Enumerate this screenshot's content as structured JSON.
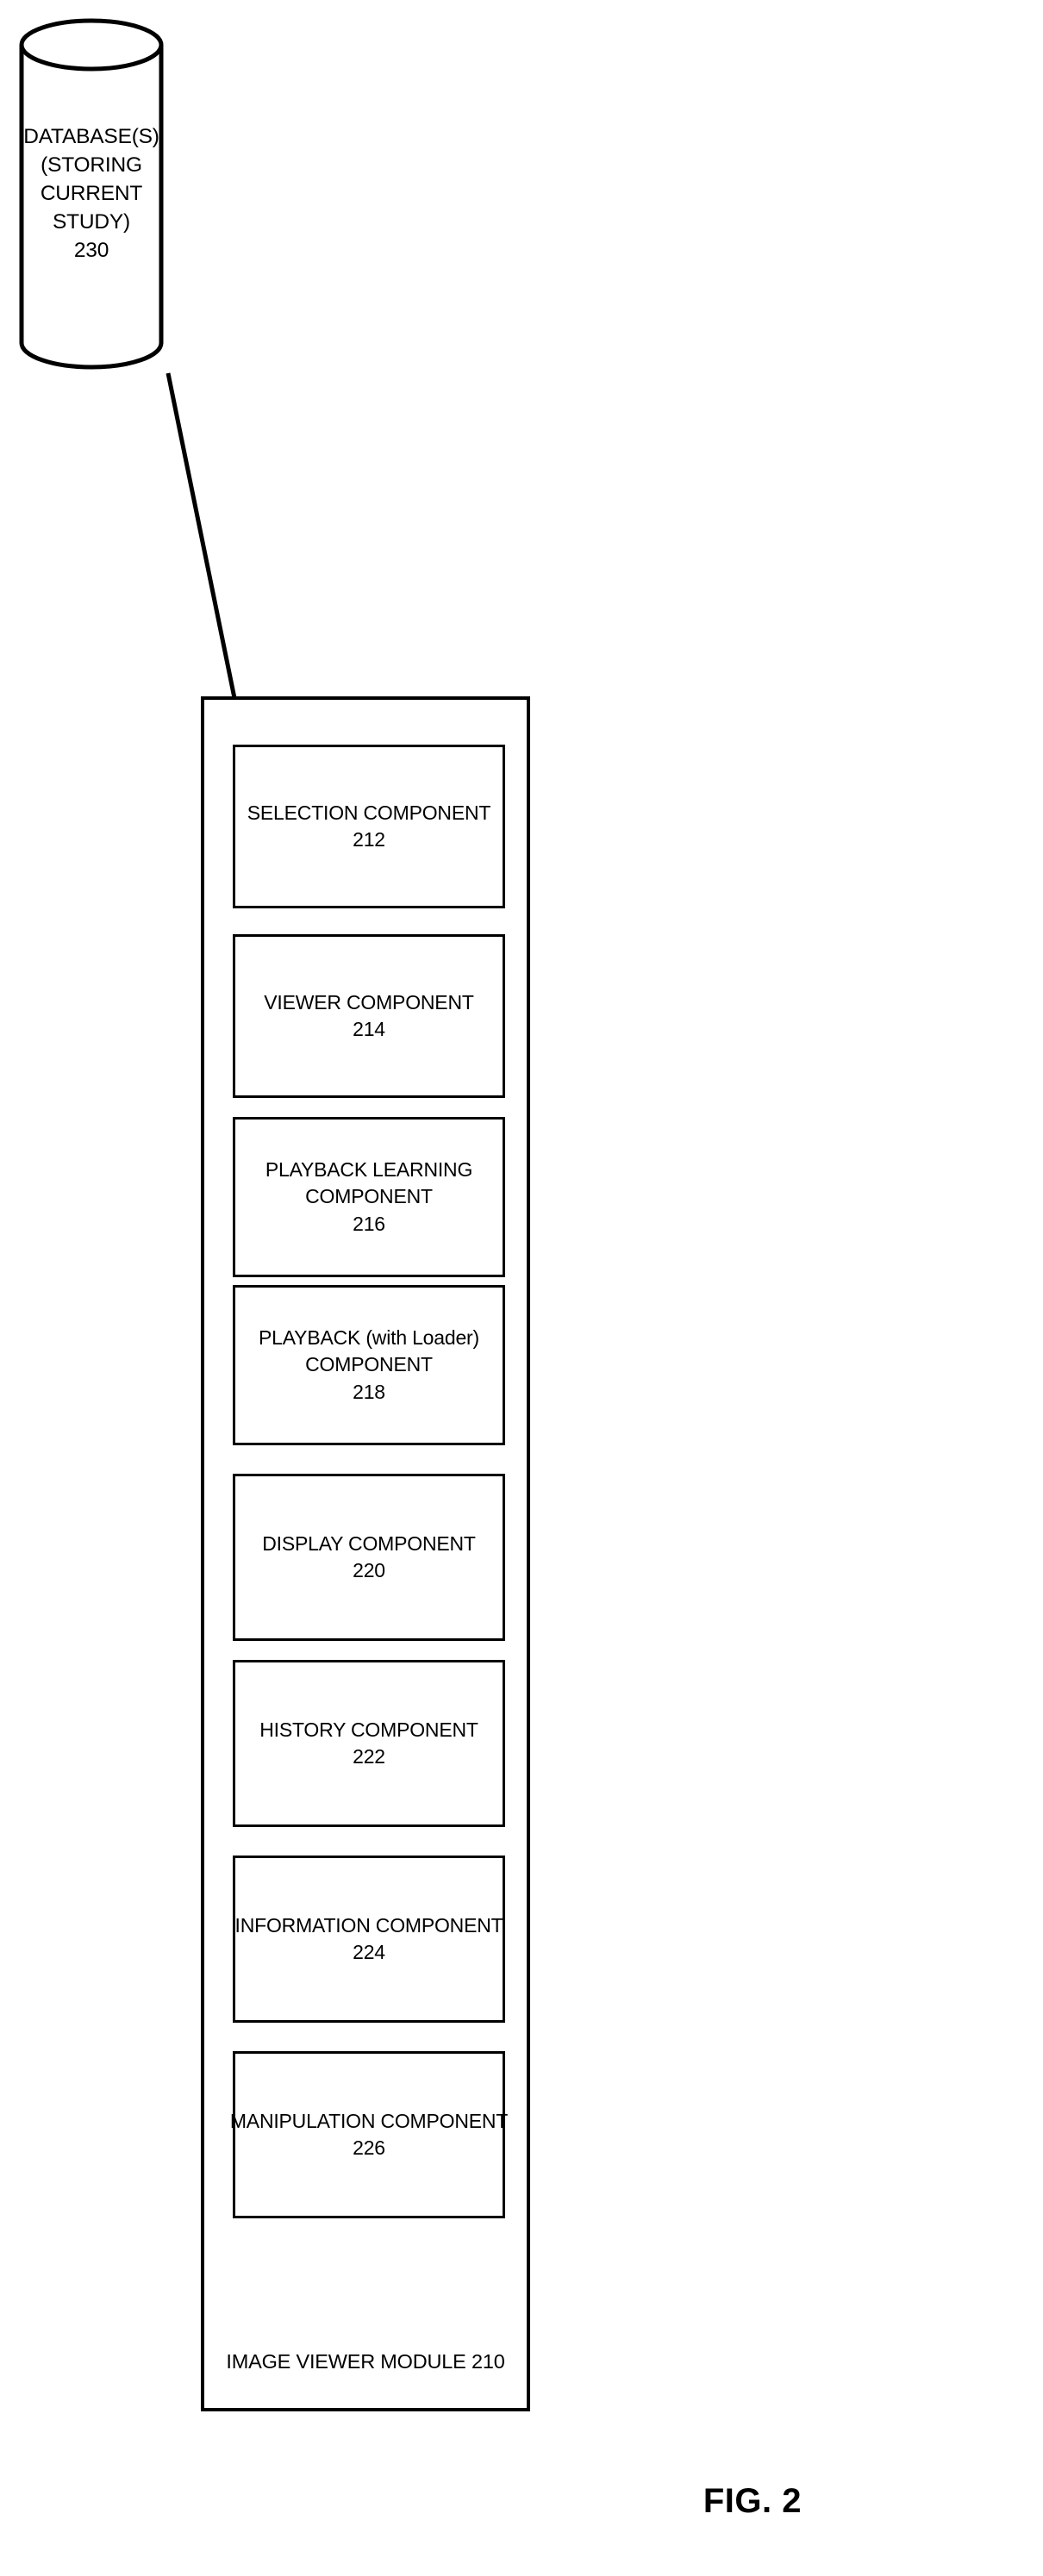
{
  "figure": {
    "caption": "FIG. 2"
  },
  "database": {
    "name": "database-cylinder",
    "lines": [
      "DATABASE(S)",
      "(STORING",
      "CURRENT",
      "STUDY)",
      "230"
    ]
  },
  "connector": {
    "name": "database-to-module-connector"
  },
  "module": {
    "label": "IMAGE VIEWER MODULE 210",
    "components": [
      {
        "id": "selection-component",
        "lines": [
          "SELECTION COMPONENT",
          "212"
        ]
      },
      {
        "id": "viewer-component",
        "lines": [
          "VIEWER COMPONENT",
          "214"
        ]
      },
      {
        "id": "playback-learning-component",
        "lines": [
          "PLAYBACK LEARNING",
          "COMPONENT",
          "216"
        ]
      },
      {
        "id": "playback-with-loader-component",
        "lines": [
          "PLAYBACK (with Loader)",
          "COMPONENT",
          "218"
        ]
      },
      {
        "id": "display-component",
        "lines": [
          "DISPLAY COMPONENT",
          "220"
        ]
      },
      {
        "id": "history-component",
        "lines": [
          "HISTORY COMPONENT",
          "222"
        ]
      },
      {
        "id": "information-component",
        "lines": [
          "INFORMATION COMPONENT",
          "224"
        ]
      },
      {
        "id": "manipulation-component",
        "lines": [
          "MANIPULATION COMPONENT",
          "226"
        ]
      }
    ]
  },
  "colors": {
    "stroke": "#000000",
    "background": "#ffffff"
  }
}
